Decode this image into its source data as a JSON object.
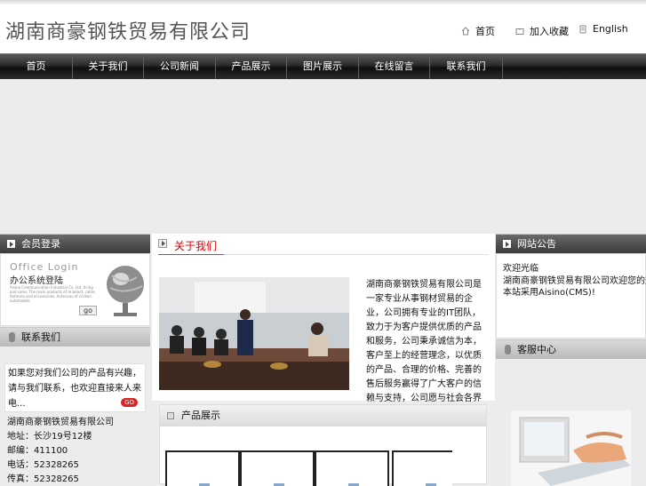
{
  "header": {
    "company": "湖南商豪钢铁贸易有限公司",
    "links": [
      {
        "label": "首页",
        "icon": "home-icon"
      },
      {
        "label": "加入收藏",
        "icon": "folder-icon"
      },
      {
        "label": "English",
        "icon": "document-icon"
      }
    ]
  },
  "nav": {
    "items": [
      "首页",
      "关于我们",
      "公司新闻",
      "产品展示",
      "图片展示",
      "在线留言",
      "联系我们"
    ]
  },
  "left": {
    "login_title": "会员登录",
    "office_login": "Office Login",
    "login_box_title": "办公系统登陆",
    "login_small": "Aisino Communication Industrial Co. Ltd. ticing and sales. The main products of m board, cable, Antenna and accessories, Antennas of civilian automobile",
    "go_label": "go",
    "contact_title": "联系我们",
    "contact_note": "如果您对我们公司的产品有兴趣，请与我们联系，也欢迎直接来人来电...",
    "contact_go": "GO",
    "contact_lines": [
      "湖南商豪钢铁贸易有限公司",
      "地址：长沙19号12楼",
      "邮编：411100",
      "电话：52328265",
      "传真：52328265"
    ]
  },
  "center": {
    "about_title": "关于我们",
    "about_text": "湖南商豪钢铁贸易有限公司是一家专业从事钢材贸易的企业，公司拥有专业的IT团队，致力于为客户提供优质的产品和服务，公司秉承诚信为本，客户至上的经营理念，以优质的产品、合理的价格、完善的售后服务赢得了广大客户的信赖与支持，公司愿与社会各界朋友携手合作，共创美好未来，欢迎新老客户来电洽谈业务...... <<更多详细>>",
    "products_title": "产品展示"
  },
  "right": {
    "notice_title": "网站公告",
    "notice_lines": [
      "欢迎光临",
      "湖南商豪钢铁贸易有限公司欢迎您的光临 ...",
      "本站采用Aisino(CMS)!"
    ],
    "service_title": "客服中心"
  }
}
